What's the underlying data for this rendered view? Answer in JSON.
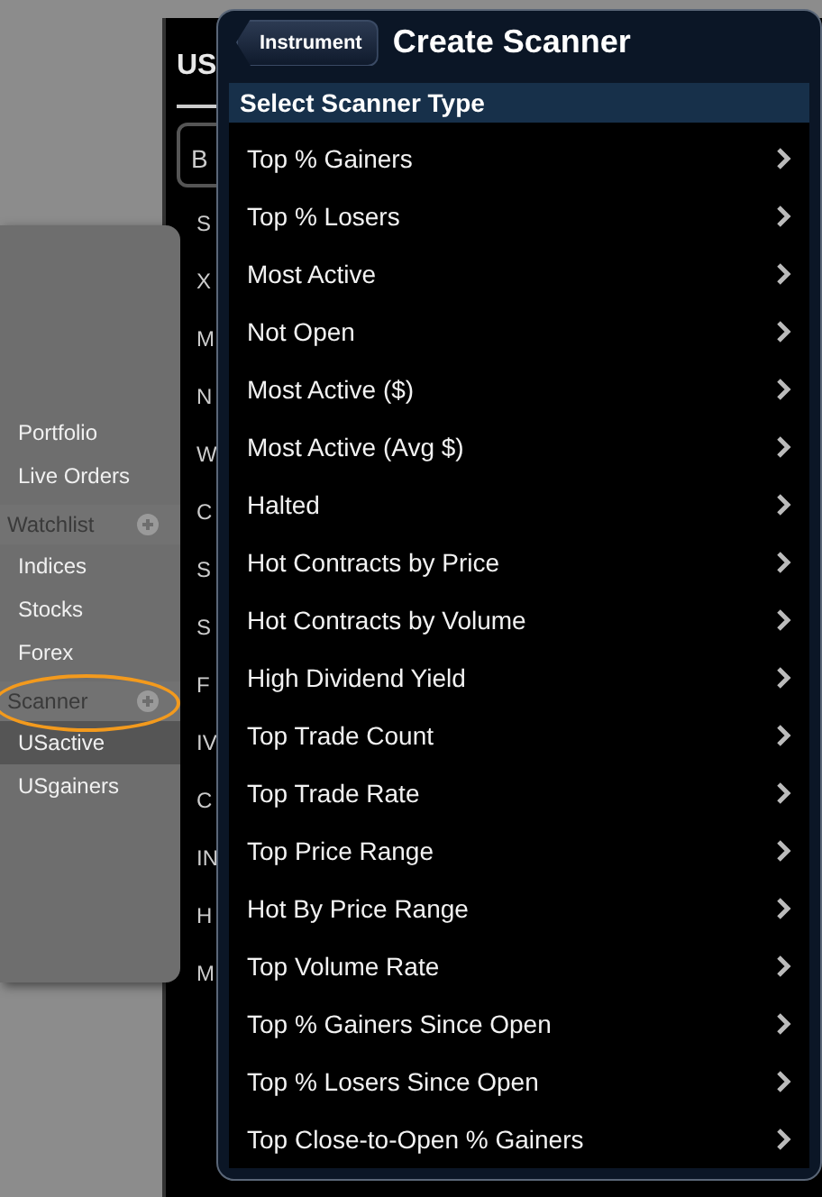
{
  "background": {
    "title": "US",
    "row_letters": [
      "B",
      "S",
      "X",
      "M",
      "N",
      "W",
      "C",
      "S",
      "S",
      "F",
      "IV",
      "C",
      "IN",
      "H",
      "M"
    ]
  },
  "sidebar": {
    "items": [
      {
        "kind": "item",
        "label": "Portfolio",
        "selected": false
      },
      {
        "kind": "item",
        "label": "Live Orders",
        "selected": false
      },
      {
        "kind": "header",
        "label": "Watchlist",
        "circled": false
      },
      {
        "kind": "item",
        "label": "Indices",
        "selected": false
      },
      {
        "kind": "item",
        "label": "Stocks",
        "selected": false
      },
      {
        "kind": "item",
        "label": "Forex",
        "selected": false
      },
      {
        "kind": "header",
        "label": "Scanner",
        "circled": true
      },
      {
        "kind": "item",
        "label": "USactive",
        "selected": true
      },
      {
        "kind": "item",
        "label": "USgainers",
        "selected": false
      }
    ]
  },
  "popover": {
    "back_button": "Instrument",
    "title": "Create Scanner",
    "section_header": "Select Scanner Type",
    "items": [
      "Top % Gainers",
      "Top % Losers",
      "Most Active",
      "Not Open",
      "Most Active ($)",
      "Most Active (Avg $)",
      "Halted",
      "Hot Contracts by Price",
      "Hot Contracts by Volume",
      "High Dividend Yield",
      "Top Trade Count",
      "Top Trade Rate",
      "Top Price Range",
      "Hot By Price Range",
      "Top Volume Rate",
      "Top % Gainers Since Open",
      "Top % Losers Since Open",
      "Top Close-to-Open % Gainers"
    ]
  }
}
